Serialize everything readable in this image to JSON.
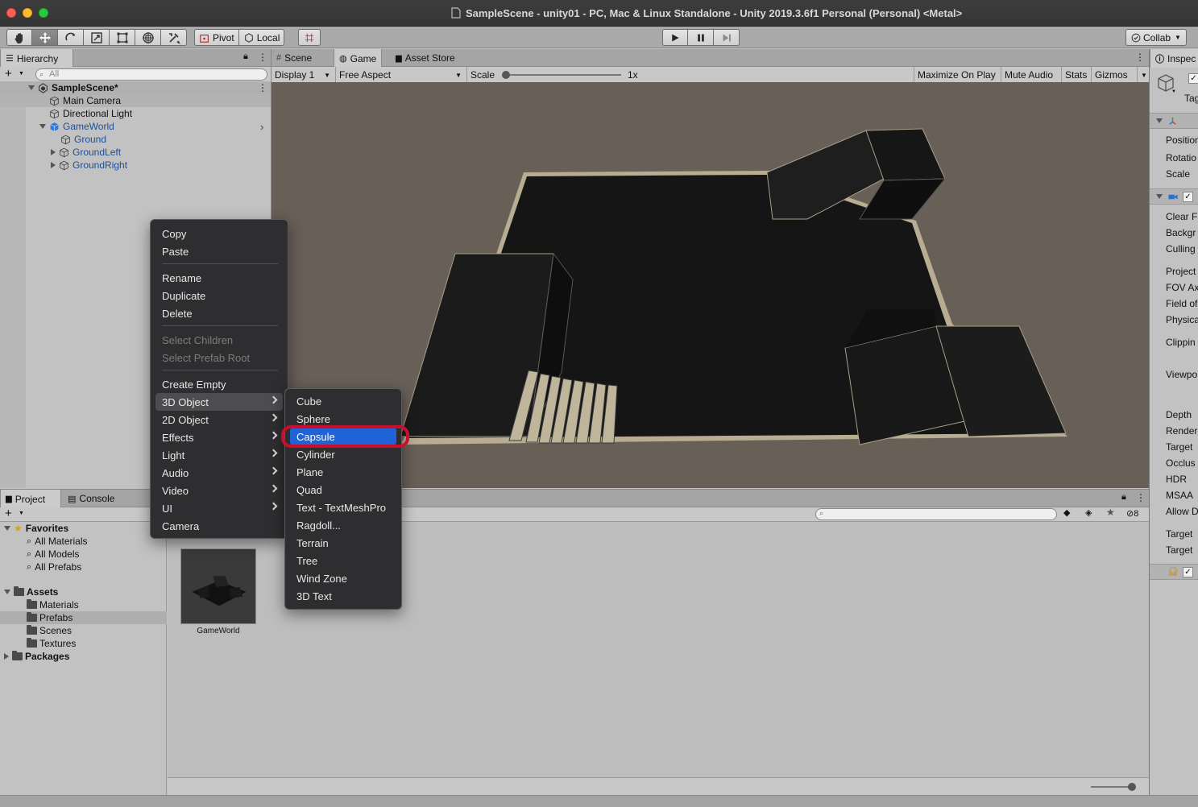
{
  "window": {
    "title": "SampleScene - unity01 - PC, Mac & Linux Standalone - Unity 2019.3.6f1 Personal (Personal) <Metal>"
  },
  "toolbar": {
    "tools": [
      "hand-tool-icon",
      "move-tool-icon",
      "rotate-tool-icon",
      "scale-tool-icon",
      "rect-tool-icon",
      "transform-tool-icon",
      "custom-tool-icon"
    ],
    "pivot_label": "Pivot",
    "local_label": "Local",
    "collab_label": "Collab"
  },
  "hierarchy": {
    "tab_label": "Hierarchy",
    "search_placeholder": "All",
    "scene_name": "SampleScene*",
    "items": [
      {
        "label": "Main Camera"
      },
      {
        "label": "Directional Light"
      },
      {
        "label": "GameWorld"
      },
      {
        "label": "Ground"
      },
      {
        "label": "GroundLeft"
      },
      {
        "label": "GroundRight"
      }
    ]
  },
  "scene_tabs": {
    "scene": "Scene",
    "game": "Game",
    "asset_store": "Asset Store"
  },
  "game_bar": {
    "display": "Display 1",
    "aspect": "Free Aspect",
    "scale_label": "Scale",
    "scale_value": "1x",
    "maximize": "Maximize On Play",
    "mute": "Mute Audio",
    "stats": "Stats",
    "gizmos": "Gizmos"
  },
  "inspector": {
    "tab_label": "Inspec",
    "tag_label": "Tag",
    "transform_rows": [
      "Position",
      "Rotatio",
      "Scale"
    ],
    "camera_rows": [
      "Clear F",
      "Backgr",
      "Culling",
      "Project",
      "FOV Ax",
      "Field of",
      "Physica",
      "Clippin",
      "Viewpo",
      "Depth",
      "Render",
      "Target",
      "Occlus",
      "HDR",
      "MSAA",
      "Allow D",
      "Target",
      "Target"
    ]
  },
  "project": {
    "tab_project": "Project",
    "tab_console": "Console",
    "favorites_label": "Favorites",
    "favorites": [
      "All Materials",
      "All Models",
      "All Prefabs"
    ],
    "assets_label": "Assets",
    "assets": [
      "Materials",
      "Prefabs",
      "Scenes",
      "Textures"
    ],
    "packages_label": "Packages",
    "asset_tile_label": "GameWorld",
    "hidden_count": "8"
  },
  "context_menu": {
    "items": [
      "Copy",
      "Paste",
      "Rename",
      "Duplicate",
      "Delete",
      "Select Children",
      "Select Prefab Root",
      "Create Empty",
      "3D Object",
      "2D Object",
      "Effects",
      "Light",
      "Audio",
      "Video",
      "UI",
      "Camera"
    ]
  },
  "submenu_3d": {
    "items": [
      "Cube",
      "Sphere",
      "Capsule",
      "Cylinder",
      "Plane",
      "Quad",
      "Text - TextMeshPro",
      "Ragdoll...",
      "Terrain",
      "Tree",
      "Wind Zone",
      "3D Text"
    ],
    "highlighted": "Capsule"
  },
  "colors": {
    "menu_highlight": "#1f63d6",
    "annotation_ring": "#c8102e",
    "hierarchy_blue": "#1d4f98",
    "game_background": "#685f57"
  }
}
